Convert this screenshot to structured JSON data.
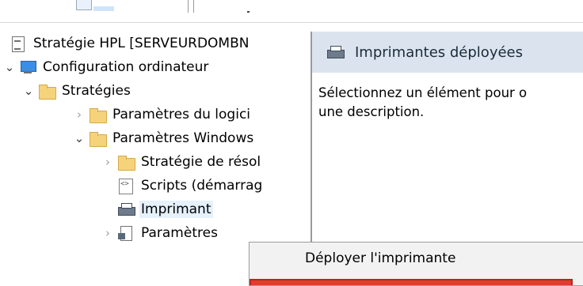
{
  "tree": {
    "items": [
      {
        "label": "Stratégie HPL [SERVEURDOMBN",
        "icon": "document-icon",
        "expander": ""
      },
      {
        "label": "Configuration ordinateur",
        "icon": "computer-icon",
        "expander": "expanded"
      },
      {
        "label": "Stratégies",
        "icon": "folder-icon",
        "expander": "expanded"
      },
      {
        "label": "Paramètres du logici",
        "icon": "folder-icon",
        "expander": "collapsed"
      },
      {
        "label": "Paramètres Windows",
        "icon": "folder-icon",
        "expander": "expanded"
      },
      {
        "label": "Stratégie de résol",
        "icon": "folder-icon",
        "expander": "collapsed"
      },
      {
        "label": "Scripts (démarrag",
        "icon": "scripts-icon",
        "expander": ""
      },
      {
        "label": "Imprimant",
        "icon": "printer-icon",
        "expander": "",
        "selected": true
      },
      {
        "label": "Paramètres",
        "icon": "settings-icon",
        "expander": "collapsed"
      }
    ]
  },
  "details": {
    "title": "Imprimantes déployées",
    "description_line1": "Sélectionnez un élément pour o",
    "description_line2": "une description."
  },
  "context_menu": {
    "deploy_label": "Déployer l'imprimante"
  },
  "colors": {
    "header_bg": "#dbe4ee",
    "menu_bg": "#f2f2f2",
    "highlight": "#e03c31"
  }
}
